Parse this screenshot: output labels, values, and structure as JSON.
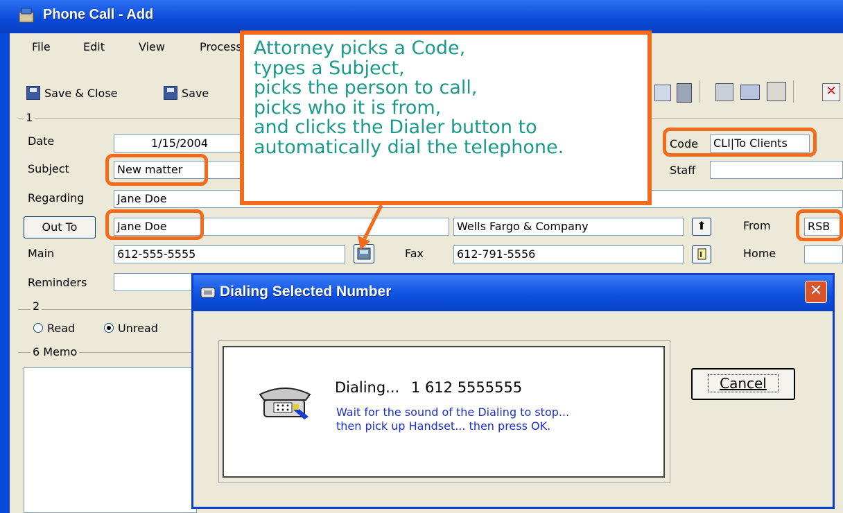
{
  "window": {
    "title": "Phone Call - Add"
  },
  "menu": [
    "File",
    "Edit",
    "View",
    "Process"
  ],
  "toolbar": {
    "save_close": "Save & Close",
    "save": "Save"
  },
  "section1": {
    "number": "1"
  },
  "fields": {
    "date_label": "Date",
    "date_value": "1/15/2004",
    "subject_label": "Subject",
    "subject_value": "New matter",
    "regarding_label": "Regarding",
    "regarding_value": "Jane Doe",
    "outto_button": "Out To",
    "outto_value": "Jane Doe",
    "company_value": "Wells Fargo & Company",
    "from_label": "From",
    "from_value": "RSB",
    "main_label": "Main",
    "main_value": "612-555-5555",
    "fax_label": "Fax",
    "fax_value": "612-791-5556",
    "home_label": "Home",
    "reminders_label": "Reminders",
    "code_label": "Code",
    "code_value": "CLI|To Clients",
    "staff_label": "Staff"
  },
  "section2": {
    "number": "2",
    "read_label": "Read",
    "unread_label": "Unread"
  },
  "memo": {
    "label": "6 Memo"
  },
  "callout": {
    "text": "Attorney picks a Code,\ntypes a Subject,\npicks the person to call,\npicks who it is from,\nand clicks the Dialer button to\nautomatically dial the telephone."
  },
  "dialog": {
    "title": "Dialing Selected Number",
    "dialing_label": "Dialing...",
    "number": "1 612 5555555",
    "instruction_1": "Wait for the sound of the Dialing to stop...",
    "instruction_2": "then pick up Handset... then press OK.",
    "cancel": "Cancel"
  },
  "colors": {
    "accent": "#f26a1b",
    "callout_text": "#1a9a8a",
    "titlebar": "#0a4ad8",
    "instruction_text": "#1a2fd0"
  }
}
